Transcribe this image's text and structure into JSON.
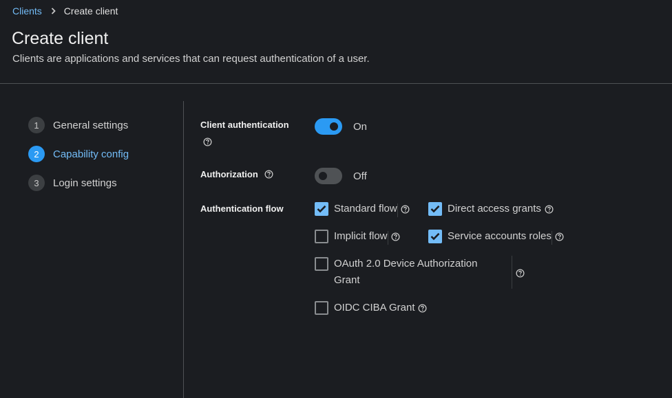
{
  "breadcrumb": {
    "parent": "Clients",
    "current": "Create client"
  },
  "header": {
    "title": "Create client",
    "description": "Clients are applications and services that can request authentication of a user."
  },
  "wizard": {
    "steps": [
      {
        "number": "1",
        "label": "General settings",
        "current": false
      },
      {
        "number": "2",
        "label": "Capability config",
        "current": true
      },
      {
        "number": "3",
        "label": "Login settings",
        "current": false
      }
    ]
  },
  "form": {
    "client_authentication": {
      "label": "Client authentication",
      "state": "On",
      "enabled": true
    },
    "authorization": {
      "label": "Authorization",
      "state": "Off",
      "enabled": false
    },
    "authentication_flow": {
      "label": "Authentication flow",
      "options": {
        "standard_flow": {
          "label": "Standard flow",
          "checked": true
        },
        "direct_access_grants": {
          "label": "Direct access grants",
          "checked": true
        },
        "implicit_flow": {
          "label": "Implicit flow",
          "checked": false
        },
        "service_accounts_roles": {
          "label": "Service accounts roles",
          "checked": true
        },
        "oauth_device_line1": "OAuth 2.0 Device Authorization",
        "oauth_device_line2": "Grant",
        "oauth_device_checked": false,
        "oidc_ciba": {
          "label": "OIDC CIBA Grant",
          "checked": false
        }
      }
    }
  },
  "colors": {
    "background": "#1b1d21",
    "accent": "#2b9af3",
    "link": "#73bcf7",
    "checkbox_checked": "#73bcf7",
    "divider": "#4f5255"
  },
  "icons": {
    "help": "question-circle-icon",
    "breadcrumb_separator": "chevron-right-icon",
    "check": "check-icon"
  }
}
